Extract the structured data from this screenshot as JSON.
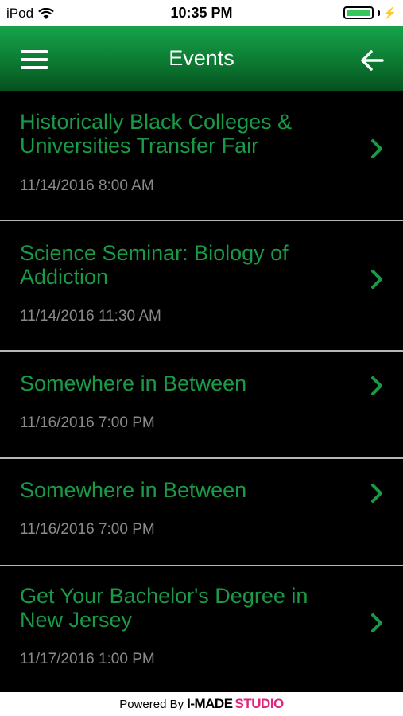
{
  "status_bar": {
    "carrier": "iPod",
    "time": "10:35 PM"
  },
  "nav": {
    "title": "Events",
    "menu_icon": "hamburger-icon",
    "back_icon": "arrow-left-icon"
  },
  "colors": {
    "accent": "#1a9a46",
    "nav_top": "#16a34a",
    "nav_bottom": "#05501e",
    "date_text": "#8a8a8a",
    "brand_pink": "#e0257a"
  },
  "events": [
    {
      "title": "Historically Black Colleges & Universities Transfer Fair",
      "date": "11/14/2016 8:00 AM"
    },
    {
      "title": "Science Seminar: Biology of Addiction",
      "date": "11/14/2016 11:30 AM"
    },
    {
      "title": "Somewhere in Between",
      "date": "11/16/2016 7:00 PM"
    },
    {
      "title": "Somewhere in Between",
      "date": "11/16/2016 7:00 PM"
    },
    {
      "title": "Get Your Bachelor's Degree in New Jersey",
      "date": "11/17/2016 1:00 PM"
    }
  ],
  "footer": {
    "powered_by": "Powered By",
    "brand_main": "I-MADE",
    "brand_accent": "STUDIO"
  }
}
